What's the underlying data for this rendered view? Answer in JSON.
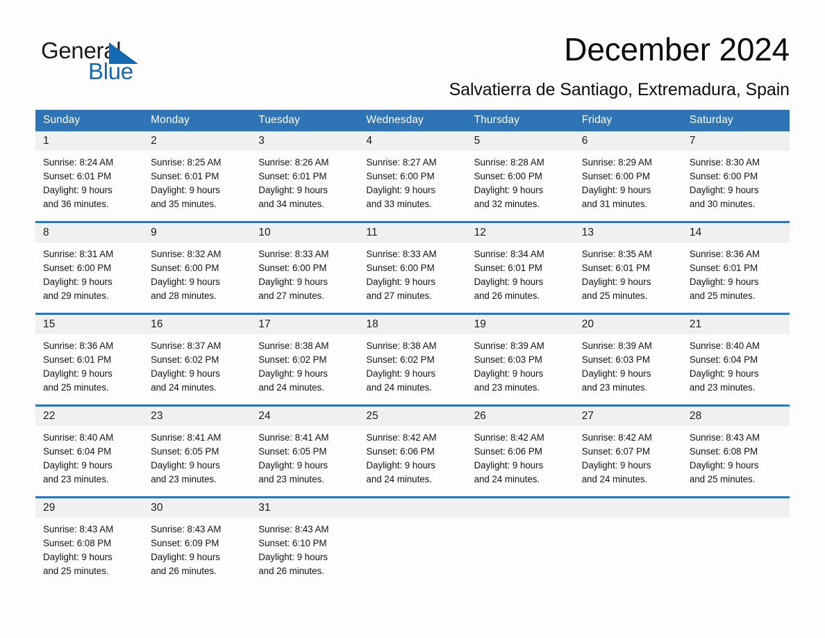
{
  "brand": {
    "word_one": "General",
    "word_two": "Blue",
    "triangle_icon": "blue-triangle-icon",
    "accent_color": "#1469b0"
  },
  "header": {
    "title": "December 2024",
    "subtitle": "Salvatierra de Santiago, Extremadura, Spain"
  },
  "theme": {
    "header_blue": "#2f74b5",
    "daynum_gray": "#f0f0f0",
    "page_background": "#fdfdfd",
    "text_color": "#141414"
  },
  "calendar": {
    "weekday_headers": [
      "Sunday",
      "Monday",
      "Tuesday",
      "Wednesday",
      "Thursday",
      "Friday",
      "Saturday"
    ],
    "weeks": [
      [
        {
          "day": "1",
          "sunrise": "Sunrise: 8:24 AM",
          "sunset": "Sunset: 6:01 PM",
          "daylight_line1": "Daylight: 9 hours",
          "daylight_line2": "and 36 minutes."
        },
        {
          "day": "2",
          "sunrise": "Sunrise: 8:25 AM",
          "sunset": "Sunset: 6:01 PM",
          "daylight_line1": "Daylight: 9 hours",
          "daylight_line2": "and 35 minutes."
        },
        {
          "day": "3",
          "sunrise": "Sunrise: 8:26 AM",
          "sunset": "Sunset: 6:01 PM",
          "daylight_line1": "Daylight: 9 hours",
          "daylight_line2": "and 34 minutes."
        },
        {
          "day": "4",
          "sunrise": "Sunrise: 8:27 AM",
          "sunset": "Sunset: 6:00 PM",
          "daylight_line1": "Daylight: 9 hours",
          "daylight_line2": "and 33 minutes."
        },
        {
          "day": "5",
          "sunrise": "Sunrise: 8:28 AM",
          "sunset": "Sunset: 6:00 PM",
          "daylight_line1": "Daylight: 9 hours",
          "daylight_line2": "and 32 minutes."
        },
        {
          "day": "6",
          "sunrise": "Sunrise: 8:29 AM",
          "sunset": "Sunset: 6:00 PM",
          "daylight_line1": "Daylight: 9 hours",
          "daylight_line2": "and 31 minutes."
        },
        {
          "day": "7",
          "sunrise": "Sunrise: 8:30 AM",
          "sunset": "Sunset: 6:00 PM",
          "daylight_line1": "Daylight: 9 hours",
          "daylight_line2": "and 30 minutes."
        }
      ],
      [
        {
          "day": "8",
          "sunrise": "Sunrise: 8:31 AM",
          "sunset": "Sunset: 6:00 PM",
          "daylight_line1": "Daylight: 9 hours",
          "daylight_line2": "and 29 minutes."
        },
        {
          "day": "9",
          "sunrise": "Sunrise: 8:32 AM",
          "sunset": "Sunset: 6:00 PM",
          "daylight_line1": "Daylight: 9 hours",
          "daylight_line2": "and 28 minutes."
        },
        {
          "day": "10",
          "sunrise": "Sunrise: 8:33 AM",
          "sunset": "Sunset: 6:00 PM",
          "daylight_line1": "Daylight: 9 hours",
          "daylight_line2": "and 27 minutes."
        },
        {
          "day": "11",
          "sunrise": "Sunrise: 8:33 AM",
          "sunset": "Sunset: 6:00 PM",
          "daylight_line1": "Daylight: 9 hours",
          "daylight_line2": "and 27 minutes."
        },
        {
          "day": "12",
          "sunrise": "Sunrise: 8:34 AM",
          "sunset": "Sunset: 6:01 PM",
          "daylight_line1": "Daylight: 9 hours",
          "daylight_line2": "and 26 minutes."
        },
        {
          "day": "13",
          "sunrise": "Sunrise: 8:35 AM",
          "sunset": "Sunset: 6:01 PM",
          "daylight_line1": "Daylight: 9 hours",
          "daylight_line2": "and 25 minutes."
        },
        {
          "day": "14",
          "sunrise": "Sunrise: 8:36 AM",
          "sunset": "Sunset: 6:01 PM",
          "daylight_line1": "Daylight: 9 hours",
          "daylight_line2": "and 25 minutes."
        }
      ],
      [
        {
          "day": "15",
          "sunrise": "Sunrise: 8:36 AM",
          "sunset": "Sunset: 6:01 PM",
          "daylight_line1": "Daylight: 9 hours",
          "daylight_line2": "and 25 minutes."
        },
        {
          "day": "16",
          "sunrise": "Sunrise: 8:37 AM",
          "sunset": "Sunset: 6:02 PM",
          "daylight_line1": "Daylight: 9 hours",
          "daylight_line2": "and 24 minutes."
        },
        {
          "day": "17",
          "sunrise": "Sunrise: 8:38 AM",
          "sunset": "Sunset: 6:02 PM",
          "daylight_line1": "Daylight: 9 hours",
          "daylight_line2": "and 24 minutes."
        },
        {
          "day": "18",
          "sunrise": "Sunrise: 8:38 AM",
          "sunset": "Sunset: 6:02 PM",
          "daylight_line1": "Daylight: 9 hours",
          "daylight_line2": "and 24 minutes."
        },
        {
          "day": "19",
          "sunrise": "Sunrise: 8:39 AM",
          "sunset": "Sunset: 6:03 PM",
          "daylight_line1": "Daylight: 9 hours",
          "daylight_line2": "and 23 minutes."
        },
        {
          "day": "20",
          "sunrise": "Sunrise: 8:39 AM",
          "sunset": "Sunset: 6:03 PM",
          "daylight_line1": "Daylight: 9 hours",
          "daylight_line2": "and 23 minutes."
        },
        {
          "day": "21",
          "sunrise": "Sunrise: 8:40 AM",
          "sunset": "Sunset: 6:04 PM",
          "daylight_line1": "Daylight: 9 hours",
          "daylight_line2": "and 23 minutes."
        }
      ],
      [
        {
          "day": "22",
          "sunrise": "Sunrise: 8:40 AM",
          "sunset": "Sunset: 6:04 PM",
          "daylight_line1": "Daylight: 9 hours",
          "daylight_line2": "and 23 minutes."
        },
        {
          "day": "23",
          "sunrise": "Sunrise: 8:41 AM",
          "sunset": "Sunset: 6:05 PM",
          "daylight_line1": "Daylight: 9 hours",
          "daylight_line2": "and 23 minutes."
        },
        {
          "day": "24",
          "sunrise": "Sunrise: 8:41 AM",
          "sunset": "Sunset: 6:05 PM",
          "daylight_line1": "Daylight: 9 hours",
          "daylight_line2": "and 23 minutes."
        },
        {
          "day": "25",
          "sunrise": "Sunrise: 8:42 AM",
          "sunset": "Sunset: 6:06 PM",
          "daylight_line1": "Daylight: 9 hours",
          "daylight_line2": "and 24 minutes."
        },
        {
          "day": "26",
          "sunrise": "Sunrise: 8:42 AM",
          "sunset": "Sunset: 6:06 PM",
          "daylight_line1": "Daylight: 9 hours",
          "daylight_line2": "and 24 minutes."
        },
        {
          "day": "27",
          "sunrise": "Sunrise: 8:42 AM",
          "sunset": "Sunset: 6:07 PM",
          "daylight_line1": "Daylight: 9 hours",
          "daylight_line2": "and 24 minutes."
        },
        {
          "day": "28",
          "sunrise": "Sunrise: 8:43 AM",
          "sunset": "Sunset: 6:08 PM",
          "daylight_line1": "Daylight: 9 hours",
          "daylight_line2": "and 25 minutes."
        }
      ],
      [
        {
          "day": "29",
          "sunrise": "Sunrise: 8:43 AM",
          "sunset": "Sunset: 6:08 PM",
          "daylight_line1": "Daylight: 9 hours",
          "daylight_line2": "and 25 minutes."
        },
        {
          "day": "30",
          "sunrise": "Sunrise: 8:43 AM",
          "sunset": "Sunset: 6:09 PM",
          "daylight_line1": "Daylight: 9 hours",
          "daylight_line2": "and 26 minutes."
        },
        {
          "day": "31",
          "sunrise": "Sunrise: 8:43 AM",
          "sunset": "Sunset: 6:10 PM",
          "daylight_line1": "Daylight: 9 hours",
          "daylight_line2": "and 26 minutes."
        },
        {
          "day": "",
          "sunrise": "",
          "sunset": "",
          "daylight_line1": "",
          "daylight_line2": ""
        },
        {
          "day": "",
          "sunrise": "",
          "sunset": "",
          "daylight_line1": "",
          "daylight_line2": ""
        },
        {
          "day": "",
          "sunrise": "",
          "sunset": "",
          "daylight_line1": "",
          "daylight_line2": ""
        },
        {
          "day": "",
          "sunrise": "",
          "sunset": "",
          "daylight_line1": "",
          "daylight_line2": ""
        }
      ]
    ]
  }
}
